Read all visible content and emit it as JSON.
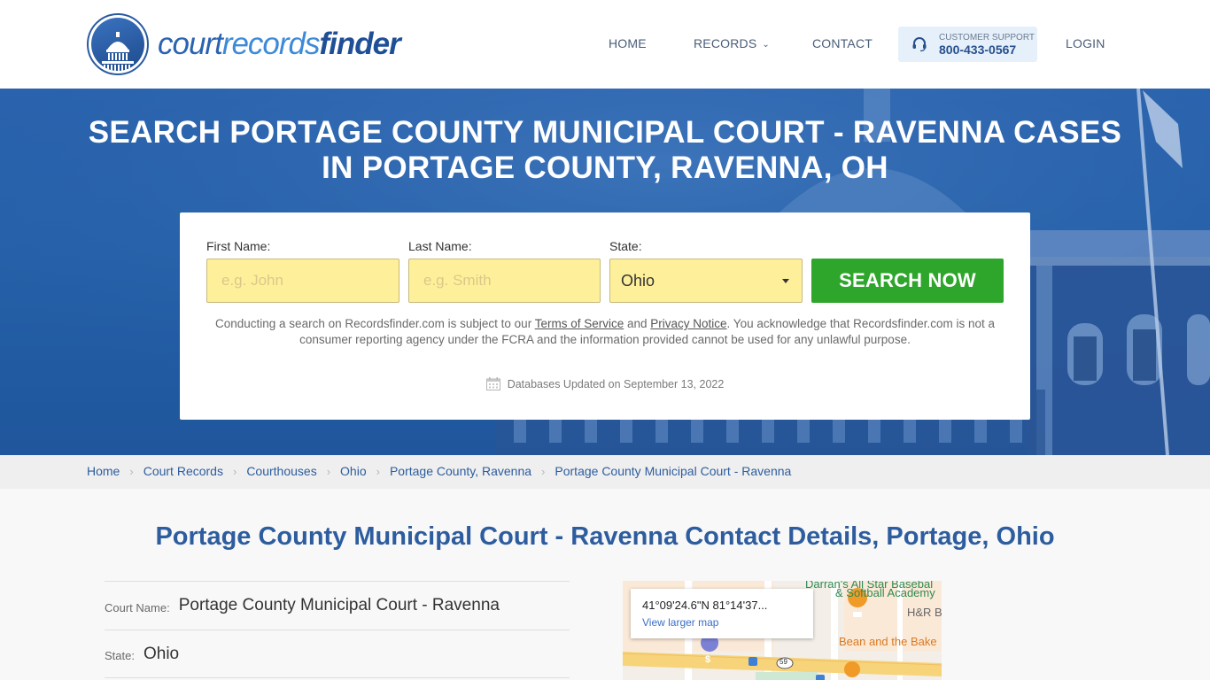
{
  "header": {
    "logo": {
      "part1": "court",
      "part2": "records",
      "part3": "finder"
    },
    "nav": [
      {
        "label": "HOME"
      },
      {
        "label": "RECORDS",
        "has_dropdown": true
      },
      {
        "label": "CONTACT"
      }
    ],
    "support": {
      "label": "CUSTOMER SUPPORT",
      "phone": "800-433-0567",
      "icon": "headset-icon"
    },
    "login_label": "LOGIN"
  },
  "hero": {
    "title_line1": "SEARCH PORTAGE COUNTY MUNICIPAL COURT - RAVENNA CASES",
    "title_line2": "IN PORTAGE COUNTY, RAVENNA, OH"
  },
  "search": {
    "first_name": {
      "label": "First Name:",
      "placeholder": "e.g. John",
      "value": ""
    },
    "last_name": {
      "label": "Last Name:",
      "placeholder": "e.g. Smith",
      "value": ""
    },
    "state": {
      "label": "State:",
      "value": "Ohio"
    },
    "button_label": "SEARCH NOW",
    "disclaimer": {
      "part1": "Conducting a search on Recordsfinder.com is subject to our ",
      "terms_link": "Terms of Service",
      "part2": " and ",
      "privacy_link": "Privacy Notice",
      "part3": ". You acknowledge that Recordsfinder.com is not a consumer reporting agency under the FCRA and the information provided cannot be used for any unlawful purpose."
    },
    "updated": "Databases Updated on September 13, 2022"
  },
  "breadcrumb": [
    {
      "label": "Home"
    },
    {
      "label": "Court Records"
    },
    {
      "label": "Courthouses"
    },
    {
      "label": "Ohio"
    },
    {
      "label": "Portage County, Ravenna"
    },
    {
      "label": "Portage County Municipal Court - Ravenna"
    }
  ],
  "main": {
    "title": "Portage County Municipal Court - Ravenna Contact Details, Portage, Ohio",
    "details": [
      {
        "label": "Court Name:",
        "value": "Portage County Municipal Court - Ravenna"
      },
      {
        "label": "State:",
        "value": "Ohio"
      }
    ]
  },
  "map": {
    "coords": "41°09'24.6\"N 81°14'37...",
    "link_label": "View larger map",
    "pois": {
      "academy_line1": "Darran's All Star Basebal",
      "academy_line2": "& Softball Academy",
      "hr": "H&R B",
      "bakery": "Bean and the Bake",
      "route": "59"
    }
  },
  "colors": {
    "brand_blue": "#2d5d9e",
    "hero_blue": "#2560a8",
    "search_green": "#2ea52b",
    "input_yellow": "#fef09a",
    "support_bg": "#e6f0fa"
  }
}
